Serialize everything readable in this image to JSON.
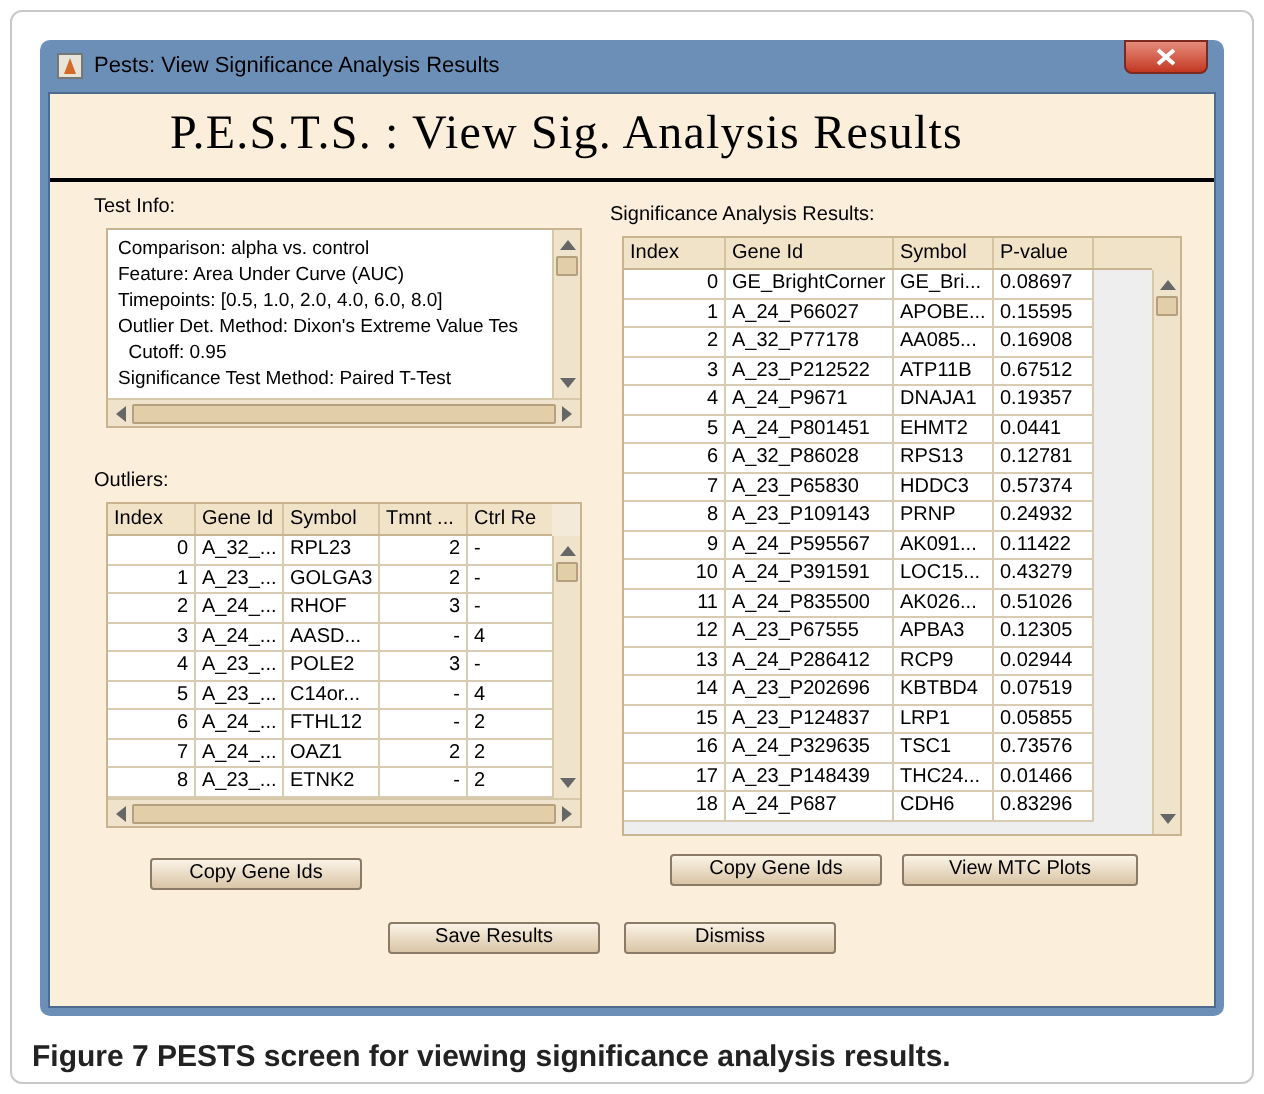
{
  "window": {
    "title": "Pests: View Significance Analysis Results"
  },
  "banner": "P.E.S.T.S. : View Sig. Analysis Results",
  "test_info": {
    "label": "Test Info:",
    "lines": [
      "Comparison: alpha vs. control",
      "Feature: Area Under Curve (AUC)",
      "Timepoints: [0.5, 1.0, 2.0, 4.0, 6.0, 8.0]",
      "Outlier Det. Method: Dixon's Extreme Value Tes",
      "  Cutoff: 0.95",
      "Significance Test Method: Paired T-Test"
    ]
  },
  "outliers": {
    "label": "Outliers:",
    "columns": [
      "Index",
      "Gene Id",
      "Symbol",
      "Tmnt ...",
      "Ctrl Re"
    ],
    "rows": [
      [
        "0",
        "A_32_...",
        "RPL23",
        "2",
        "-"
      ],
      [
        "1",
        "A_23_...",
        "GOLGA3",
        "2",
        "-"
      ],
      [
        "2",
        "A_24_...",
        "RHOF",
        "3",
        "-"
      ],
      [
        "3",
        "A_24_...",
        "AASD...",
        "-",
        "4"
      ],
      [
        "4",
        "A_23_...",
        "POLE2",
        "3",
        "-"
      ],
      [
        "5",
        "A_23_...",
        "C14or...",
        "-",
        "4"
      ],
      [
        "6",
        "A_24_...",
        "FTHL12",
        "-",
        "2"
      ],
      [
        "7",
        "A_24_...",
        "OAZ1",
        "2",
        "2"
      ],
      [
        "8",
        "A_23_...",
        "ETNK2",
        "-",
        "2"
      ]
    ],
    "button": "Copy Gene Ids"
  },
  "results": {
    "label": "Significance Analysis Results:",
    "columns": [
      "Index",
      "Gene Id",
      "Symbol",
      "P-value"
    ],
    "rows": [
      [
        "0",
        "GE_BrightCorner",
        "GE_Bri...",
        "0.08697"
      ],
      [
        "1",
        "A_24_P66027",
        "APOBE...",
        "0.15595"
      ],
      [
        "2",
        "A_32_P77178",
        "AA085...",
        "0.16908"
      ],
      [
        "3",
        "A_23_P212522",
        "ATP11B",
        "0.67512"
      ],
      [
        "4",
        "A_24_P9671",
        "DNAJA1",
        "0.19357"
      ],
      [
        "5",
        "A_24_P801451",
        "EHMT2",
        "0.0441"
      ],
      [
        "6",
        "A_32_P86028",
        "RPS13",
        "0.12781"
      ],
      [
        "7",
        "A_23_P65830",
        "HDDC3",
        "0.57374"
      ],
      [
        "8",
        "A_23_P109143",
        "PRNP",
        "0.24932"
      ],
      [
        "9",
        "A_24_P595567",
        "AK091...",
        "0.11422"
      ],
      [
        "10",
        "A_24_P391591",
        "LOC15...",
        "0.43279"
      ],
      [
        "11",
        "A_24_P835500",
        "AK026...",
        "0.51026"
      ],
      [
        "12",
        "A_23_P67555",
        "APBA3",
        "0.12305"
      ],
      [
        "13",
        "A_24_P286412",
        "RCP9",
        "0.02944"
      ],
      [
        "14",
        "A_23_P202696",
        "KBTBD4",
        "0.07519"
      ],
      [
        "15",
        "A_23_P124837",
        "LRP1",
        "0.05855"
      ],
      [
        "16",
        "A_24_P329635",
        "TSC1",
        "0.73576"
      ],
      [
        "17",
        "A_23_P148439",
        "THC24...",
        "0.01466"
      ],
      [
        "18",
        "A_24_P687",
        "CDH6",
        "0.83296"
      ]
    ],
    "buttons": [
      "Copy Gene Ids",
      "View MTC Plots"
    ]
  },
  "footer_buttons": [
    "Save Results",
    "Dismiss"
  ],
  "caption": "Figure 7 PESTS screen for viewing significance analysis results."
}
